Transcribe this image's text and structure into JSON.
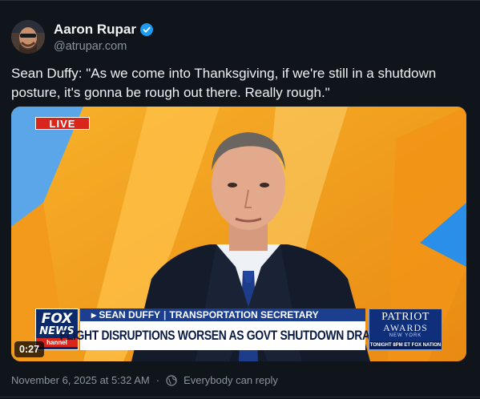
{
  "author": {
    "name": "Aaron Rupar",
    "handle": "@atrupar.com",
    "verified": true
  },
  "post": {
    "text": "Sean Duffy: \"As we come into Thanksgiving, if we're still in a shutdown posture, it's gonna be rough out there. Really rough.\"",
    "timestamp": "November 6, 2025 at 5:32 AM",
    "reply_setting": "Everybody can reply"
  },
  "video": {
    "live_label": "LIVE",
    "network_logo_line1": "FOX",
    "network_logo_line2": "NEWS",
    "network_logo_line3": "hannel",
    "chyron_name": "SEAN DUFFY",
    "chyron_title": "TRANSPORTATION SECRETARY",
    "chyron_headline": "FLIGHT DISRUPTIONS WORSEN AS GOVT SHUTDOWN DRAGS",
    "promo_line1": "PATRIOT",
    "promo_line2": "AWARDS",
    "promo_line3": "NEW YORK",
    "promo_line4": "TONIGHT 8PM ET FOX NATION",
    "timecode": "0:27"
  },
  "colors": {
    "background": "#10141b",
    "text": "#e7e9ea",
    "muted": "#8b949e",
    "verified": "#1d9bf0",
    "live_red": "#d9261c",
    "chyron_blue": "#1b3e8f"
  }
}
